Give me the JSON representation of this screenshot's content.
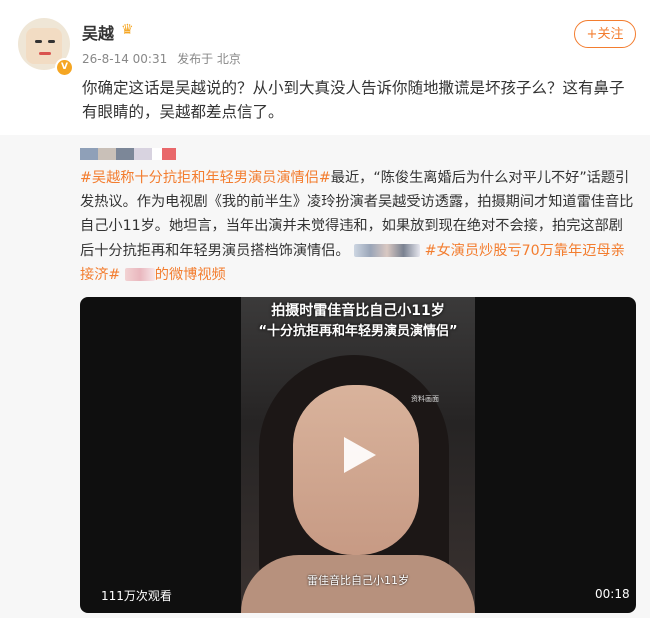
{
  "post": {
    "username": "吴越",
    "crown_icon": "crown-icon",
    "verified_icon": "verified-badge-icon",
    "date": "26-8-14 00:31",
    "location": "发布于 北京",
    "follow_label": "+关注",
    "comment": "你确定这话是吴越说的？从小到大真没人告诉你随地撒谎是坏孩子么？这有鼻子有眼睛的，吴越都差点信了。"
  },
  "repost": {
    "topic1": "#吴越称十分抗拒和年轻男演员演情侣#",
    "text1": "最近，“陈俊生离婚后为什么对平儿不好”话题引发热议。作为电视剧《我的前半生》凌玲扮演者吴越受访透露，拍摄期间才知道雷佳音比自己小11岁。她坦言，当年出演并未觉得违和，如果放到现在绝对不会接，拍完这部剧后十分抗拒再和年轻男演员搭档饰演情侣。",
    "topic2": "#女演员炒股亏70万靠年迈母亲接济#",
    "text2": "的微博视频"
  },
  "video": {
    "caption_top1": "拍摄时雷佳音比自己小11岁",
    "caption_top2": "“十分抗拒再和年轻男演员演情侣”",
    "watermark": "资料画面",
    "subtitle": "雷佳音比自己小11岁",
    "views": "111万次观看",
    "duration": "00:18",
    "play_icon": "play-icon"
  }
}
